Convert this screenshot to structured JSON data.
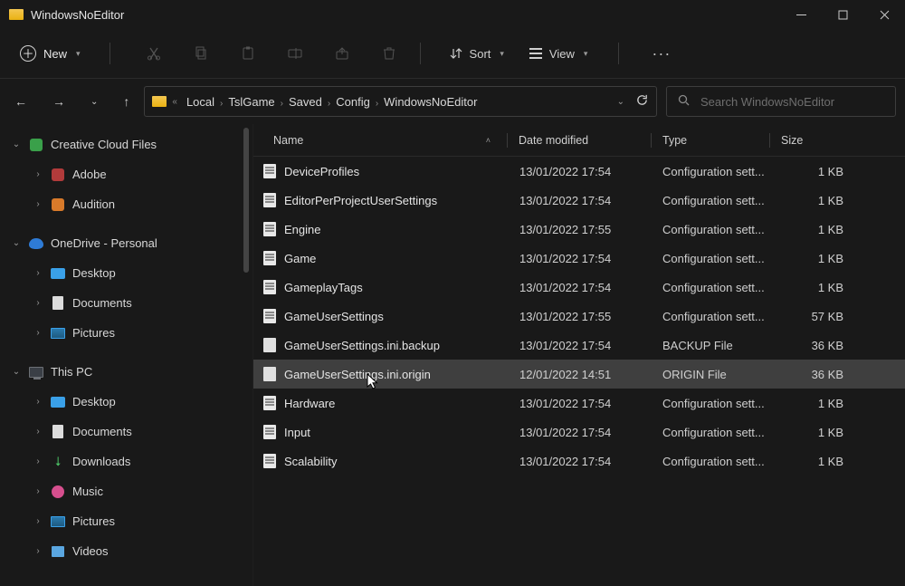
{
  "window": {
    "title": "WindowsNoEditor"
  },
  "toolbar": {
    "new_label": "New",
    "sort_label": "Sort",
    "view_label": "View"
  },
  "breadcrumbs": {
    "prefix": "«",
    "items": [
      "Local",
      "TslGame",
      "Saved",
      "Config",
      "WindowsNoEditor"
    ]
  },
  "search": {
    "placeholder": "Search WindowsNoEditor"
  },
  "sidebar": {
    "creative": "Creative Cloud Files",
    "adobe": "Adobe",
    "audition": "Audition",
    "onedrive": "OneDrive - Personal",
    "desktop": "Desktop",
    "documents": "Documents",
    "pictures": "Pictures",
    "thispc": "This PC",
    "desktop2": "Desktop",
    "documents2": "Documents",
    "downloads": "Downloads",
    "music": "Music",
    "pictures2": "Pictures",
    "videos": "Videos"
  },
  "columns": {
    "name": "Name",
    "date": "Date modified",
    "type": "Type",
    "size": "Size"
  },
  "files": [
    {
      "name": "DeviceProfiles",
      "date": "13/01/2022 17:54",
      "type": "Configuration sett...",
      "size": "1 KB",
      "icon": "cfg"
    },
    {
      "name": "EditorPerProjectUserSettings",
      "date": "13/01/2022 17:54",
      "type": "Configuration sett...",
      "size": "1 KB",
      "icon": "cfg"
    },
    {
      "name": "Engine",
      "date": "13/01/2022 17:55",
      "type": "Configuration sett...",
      "size": "1 KB",
      "icon": "cfg"
    },
    {
      "name": "Game",
      "date": "13/01/2022 17:54",
      "type": "Configuration sett...",
      "size": "1 KB",
      "icon": "cfg"
    },
    {
      "name": "GameplayTags",
      "date": "13/01/2022 17:54",
      "type": "Configuration sett...",
      "size": "1 KB",
      "icon": "cfg"
    },
    {
      "name": "GameUserSettings",
      "date": "13/01/2022 17:55",
      "type": "Configuration sett...",
      "size": "57 KB",
      "icon": "cfg"
    },
    {
      "name": "GameUserSettings.ini.backup",
      "date": "13/01/2022 17:54",
      "type": "BACKUP File",
      "size": "36 KB",
      "icon": "bak"
    },
    {
      "name": "GameUserSettings.ini.origin",
      "date": "12/01/2022 14:51",
      "type": "ORIGIN File",
      "size": "36 KB",
      "icon": "bak",
      "selected": true
    },
    {
      "name": "Hardware",
      "date": "13/01/2022 17:54",
      "type": "Configuration sett...",
      "size": "1 KB",
      "icon": "cfg"
    },
    {
      "name": "Input",
      "date": "13/01/2022 17:54",
      "type": "Configuration sett...",
      "size": "1 KB",
      "icon": "cfg"
    },
    {
      "name": "Scalability",
      "date": "13/01/2022 17:54",
      "type": "Configuration sett...",
      "size": "1 KB",
      "icon": "cfg"
    }
  ]
}
